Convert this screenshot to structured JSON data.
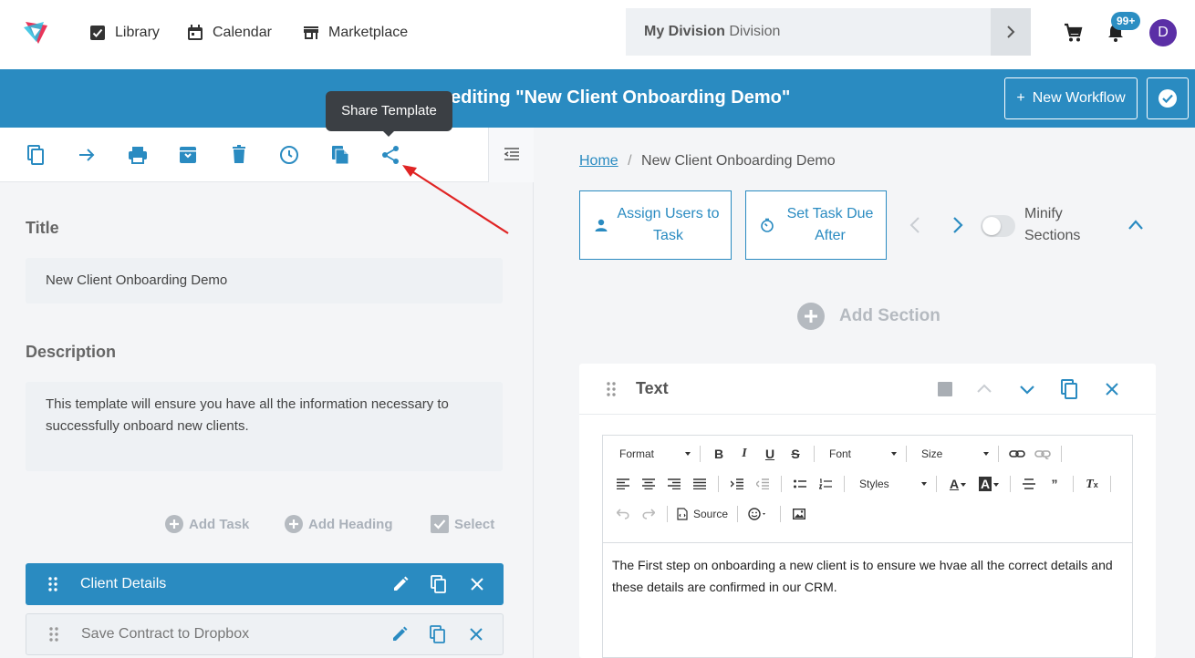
{
  "nav": {
    "library": "Library",
    "calendar": "Calendar",
    "marketplace": "Marketplace",
    "division_bold": "My Division",
    "division_rest": "Division",
    "notif_badge": "99+",
    "avatar_letter": "D"
  },
  "banner": {
    "title": "editing \"New Client Onboarding Demo\"",
    "new_workflow": "New Workflow",
    "new_workflow_plus": "+"
  },
  "tooltip": {
    "text": "Share Template"
  },
  "left": {
    "title_label": "Title",
    "title_value": "New Client Onboarding Demo",
    "desc_label": "Description",
    "desc_value": "This template will ensure you have all the information necessary to successfully onboard new clients.",
    "add_task": "Add Task",
    "add_heading": "Add Heading",
    "select": "Select",
    "tasks": [
      {
        "name": "Client Details",
        "active": true
      },
      {
        "name": "Save Contract to Dropbox",
        "active": false
      }
    ]
  },
  "right": {
    "crumb_home": "Home",
    "crumb_sep": "/",
    "crumb_current": "New Client Onboarding Demo",
    "assign_users": "Assign Users to Task",
    "set_due": "Set Task Due After",
    "minify": "Minify Sections",
    "add_section": "Add Section",
    "card_title": "Text",
    "editor": {
      "format": "Format",
      "font": "Font",
      "size": "Size",
      "styles": "Styles",
      "source": "Source",
      "body": "The First step on onboarding a new client is to ensure we hvae all the correct details and these details are confirmed in our CRM."
    }
  },
  "colors": {
    "primary": "#2a8bc1",
    "banner": "#2a8bc1",
    "avatar": "#5b2fa6",
    "arrow": "#e02424"
  }
}
